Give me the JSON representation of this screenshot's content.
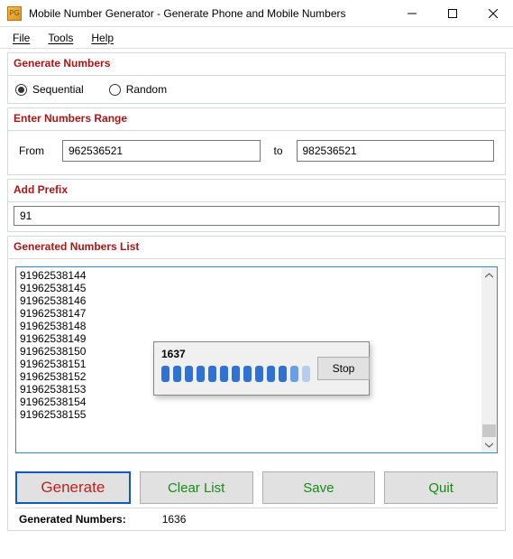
{
  "window": {
    "title": "Mobile Number Generator - Generate Phone and Mobile Numbers"
  },
  "menu": {
    "file": "File",
    "tools": "Tools",
    "help": "Help"
  },
  "sections": {
    "generate": "Generate Numbers",
    "range": "Enter Numbers Range",
    "prefix": "Add Prefix",
    "list": "Generated Numbers List"
  },
  "mode": {
    "sequential": "Sequential",
    "random": "Random"
  },
  "range": {
    "from_label": "From",
    "from_value": "962536521",
    "to_label": "to",
    "to_value": "982536521"
  },
  "prefix": {
    "value": "91"
  },
  "generated_numbers": [
    "91962538144",
    "91962538145",
    "91962538146",
    "91962538147",
    "91962538148",
    "91962538149",
    "91962538150",
    "91962538151",
    "91962538152",
    "91962538153",
    "91962538154",
    "91962538155"
  ],
  "progress": {
    "count": "1637",
    "stop_label": "Stop"
  },
  "buttons": {
    "generate": "Generate",
    "clear": "Clear List",
    "save": "Save",
    "quit": "Quit"
  },
  "status": {
    "label": "Generated Numbers:",
    "value": "1636"
  }
}
